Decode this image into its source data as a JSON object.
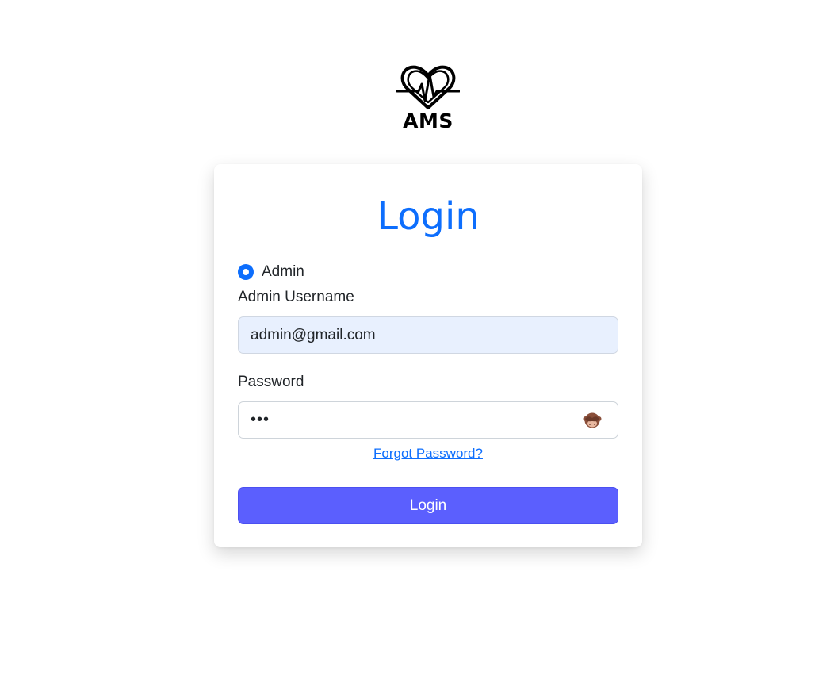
{
  "logo": {
    "icon": "heart-pulse-icon",
    "text": "AMS"
  },
  "form": {
    "title": "Login",
    "role_option": "Admin",
    "role_selected": true,
    "username_label": "Admin Username",
    "username_value": "admin@gmail.com",
    "password_label": "Password",
    "password_value": "•••",
    "password_toggle_icon": "see-no-evil-monkey-icon",
    "forgot_link": "Forgot Password?",
    "submit_label": "Login"
  },
  "colors": {
    "accent": "#0d6efd",
    "button": "#5b5ffe",
    "autofill": "#e8f0fe"
  }
}
